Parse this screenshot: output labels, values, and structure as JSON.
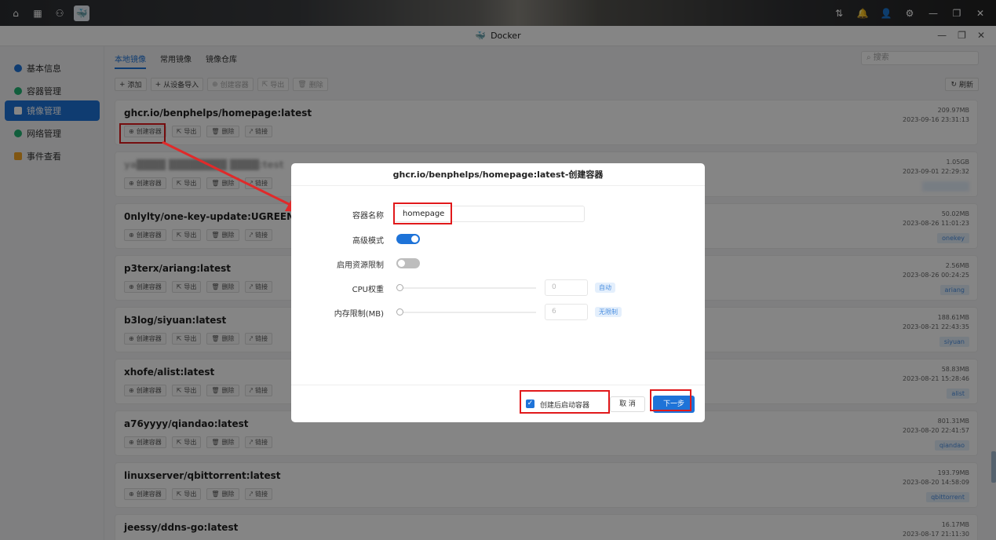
{
  "window": {
    "title": "Docker"
  },
  "sidebar": {
    "items": [
      {
        "label": "基本信息",
        "icon": "info-icon",
        "color": "#1e73d8"
      },
      {
        "label": "容器管理",
        "icon": "container-icon",
        "color": "#22b573"
      },
      {
        "label": "镜像管理",
        "icon": "image-icon",
        "color": "#1e73d8",
        "active": true
      },
      {
        "label": "网络管理",
        "icon": "network-icon",
        "color": "#22b573"
      },
      {
        "label": "事件查看",
        "icon": "event-icon",
        "color": "#f5a623"
      }
    ]
  },
  "main": {
    "tabs": [
      "本地镜像",
      "常用镜像",
      "镜像仓库"
    ],
    "search_placeholder": "搜索",
    "toolbar": {
      "add": "添加",
      "import": "从设备导入",
      "create_container": "创建容器",
      "export": "导出",
      "delete": "删除"
    },
    "refresh": "刷新",
    "action_labels": {
      "create": "创建容器",
      "export": "导出",
      "delete": "删除",
      "link": "链接"
    },
    "images": [
      {
        "name": "ghcr.io/benphelps/homepage:latest",
        "size": "209.97MB",
        "date": "2023-09-16 23:31:13",
        "tag": ""
      },
      {
        "name": "ya████ ████████ ████:test",
        "size": "1.05GB",
        "date": "2023-09-01 22:29:32",
        "tag": "blurred",
        "blurred": true
      },
      {
        "name": "0nlylty/one-key-update:UGREEN",
        "size": "50.02MB",
        "date": "2023-08-26 11:01:23",
        "tag": "onekey"
      },
      {
        "name": "p3terx/ariang:latest",
        "size": "2.56MB",
        "date": "2023-08-26 00:24:25",
        "tag": "ariang"
      },
      {
        "name": "b3log/siyuan:latest",
        "size": "188.61MB",
        "date": "2023-08-21 22:43:35",
        "tag": "siyuan"
      },
      {
        "name": "xhofe/alist:latest",
        "size": "58.83MB",
        "date": "2023-08-21 15:28:46",
        "tag": "alist"
      },
      {
        "name": "a76yyyy/qiandao:latest",
        "size": "801.31MB",
        "date": "2023-08-20 22:41:57",
        "tag": "qiandao"
      },
      {
        "name": "linuxserver/qbittorrent:latest",
        "size": "193.79MB",
        "date": "2023-08-20 14:58:09",
        "tag": "qbittorrent"
      },
      {
        "name": "jeessy/ddns-go:latest",
        "size": "16.17MB",
        "date": "2023-08-17 21:11:30",
        "tag": ""
      }
    ]
  },
  "dialog": {
    "title": "ghcr.io/benphelps/homepage:latest-创建容器",
    "container_name_label": "容器名称",
    "container_name_value": "homepage",
    "advanced_mode_label": "高级模式",
    "advanced_mode_on": true,
    "resource_limit_label": "启用资源限制",
    "resource_limit_on": false,
    "cpu_label": "CPU权重",
    "cpu_value": "0",
    "cpu_chip": "自动",
    "mem_label": "内存限制(MB)",
    "mem_value": "6",
    "mem_chip": "无限制",
    "start_after_create_label": "创建后启动容器",
    "start_after_create_checked": true,
    "cancel_label": "取 消",
    "next_label": "下一步"
  },
  "colors": {
    "accent": "#1e73d8",
    "highlight": "#e1191b",
    "arrow": "#e02a2a"
  }
}
